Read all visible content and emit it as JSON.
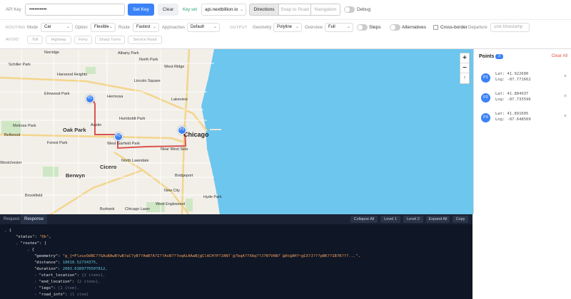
{
  "toolbar": {
    "api_key_label": "API Key",
    "api_key_value": "••••••••••",
    "set_key": "Set Key",
    "clear": "Clear",
    "key_set": "Key set",
    "host": "api.nextbillion.io",
    "modes": [
      "Directions",
      "Snap to Road",
      "Navigation"
    ],
    "debug": "Debug"
  },
  "routing": {
    "section": "ROUTING",
    "mode_label": "Mode",
    "mode_value": "Car",
    "option_label": "Option",
    "option_value": "Flexible",
    "route_label": "Route",
    "route_value": "Fastest",
    "approaches_label": "Approaches",
    "approaches_value": "Default",
    "output_section": "OUTPUT",
    "geometry_label": "Geometry",
    "geometry_value": "Polyline",
    "overview_label": "Overview",
    "overview_value": "Full",
    "steps": "Steps",
    "alternatives": "Alternatives",
    "cross_border": "Cross-border",
    "departure_label": "Departure",
    "departure_placeholder": "unix timestamp",
    "avoid_section": "AVOID",
    "avoid_chips": [
      "Toll",
      "Highway",
      "Ferry",
      "Sharp Turns",
      "Service Road"
    ]
  },
  "map": {
    "labels": {
      "norridge": "Norridge",
      "albany_park": "Albany Park",
      "schiller_park": "Schiller Park",
      "north_park": "North Park",
      "west_ridge": "West Ridge",
      "harwood_heights": "Harwood Heights",
      "lincoln_square": "Lincoln Square",
      "elmwood_park": "Elmwood Park",
      "hermosa": "Hermosa",
      "lakeview": "Lakeview",
      "melrose_park": "Melrose Park",
      "humboldt_park": "Humboldt Park",
      "oak_park": "Oak Park",
      "austin": "Austin",
      "chicago": "Chicago",
      "bellwood": "Bellwood",
      "west_garfield": "West Garfield Park",
      "near_west_side": "Near West Side",
      "forest_park": "Forest Park",
      "north_lawndale": "North Lawndale",
      "westchester": "Westchester",
      "berwyn": "Berwyn",
      "cicero": "Cicero",
      "bridgeport": "Bridgeport",
      "brookfield": "Brookfield",
      "new_city": "New City",
      "hyde_park": "Hyde Park",
      "burbank": "Burbank",
      "chicago_lawn": "Chicago Lawn",
      "west_englewood": "West Englewood"
    },
    "pins": [
      "P1",
      "P2",
      "P3"
    ],
    "zoom_in": "+",
    "zoom_out": "−",
    "reset": "↑"
  },
  "points": {
    "title": "Points",
    "count": "3",
    "clear_all": "Clear All",
    "items": [
      {
        "id": "P1",
        "lat": "Lat: 41.922600",
        "lng": "Lng: -87.771662"
      },
      {
        "id": "P2",
        "lat": "Lat: 41.884937",
        "lng": "Lng: -87.733596"
      },
      {
        "id": "P3",
        "lat": "Lat: 41.891605",
        "lng": "Lng: -87.648509"
      }
    ]
  },
  "console": {
    "tabs": [
      "Request",
      "Response"
    ],
    "buttons": [
      "Collapse All",
      "Level 1",
      "Level 2",
      "Expand All",
      "Copy"
    ],
    "response": {
      "status_key": "\"status\"",
      "status_val": "\"Ok\"",
      "routes_key": "\"routes\"",
      "geometry_key": "\"geometry\"",
      "geometry_val": "\"g_{=FlzuvOdBC??GAuBAwB?wB?aC?yB??AmB?A?I??AsB???oqAiAAwB[@ClACH?P?JAN?`@?bqA??XAq??J?N?VAN?`@At@AH?~@CX?J???pBK??1B?R???...\",",
      "distance_key": "\"distance\"",
      "distance_val": "18618.52734375,",
      "duration_key": "\"duration\"",
      "duration_val": "2083.6389770507812,",
      "start_key": "\"start_location\"",
      "start_note": "{2 items},",
      "end_key": "\"end_location\"",
      "end_note": "{2 items},",
      "legs_key": "\"legs\"",
      "legs_note": "[1 item],",
      "road_key": "\"road_info\"",
      "road_note": "{1 item}"
    }
  }
}
